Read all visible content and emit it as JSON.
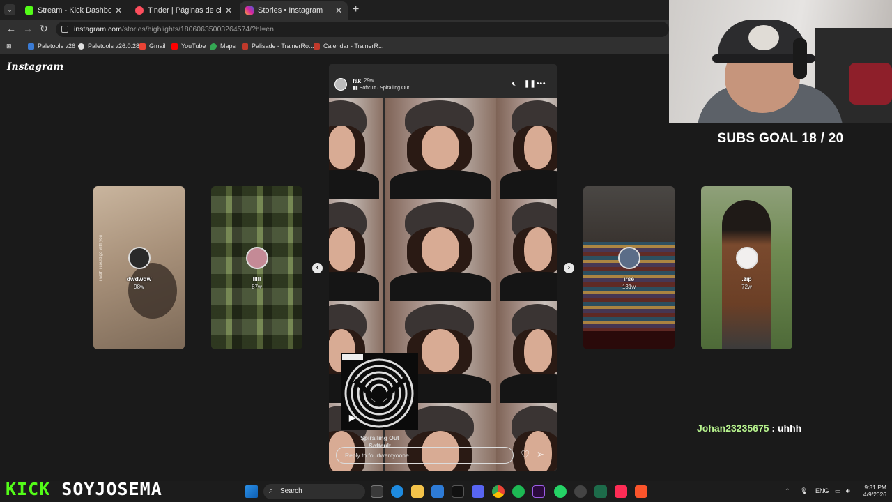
{
  "browser": {
    "tabs": [
      {
        "title": "Stream - Kick Dashboard",
        "favicon_color": "#53fc18",
        "active": false
      },
      {
        "title": "Tinder | Páginas de citas",
        "favicon_color": "#fd4e5d",
        "active": false
      },
      {
        "title": "Stories • Instagram",
        "favicon_color": "#d6249f",
        "active": true
      }
    ],
    "url_main": "instagram.com",
    "url_rest": "/stories/highlights/18060635003264574/?hl=en",
    "bookmarks": [
      {
        "label": "Paletools v26",
        "icon_color": "#3a7bd5"
      },
      {
        "label": "Paletools v26.0.28",
        "icon_color": "#e0e0e0"
      },
      {
        "label": "Gmail",
        "icon_color": "#ea4335"
      },
      {
        "label": "YouTube",
        "icon_color": "#ff0000"
      },
      {
        "label": "Maps",
        "icon_color": "#34a853"
      },
      {
        "label": "Palisade - TrainerRo...",
        "icon_color": "#c0392b"
      },
      {
        "label": "Calendar - TrainerR...",
        "icon_color": "#c0392b"
      }
    ]
  },
  "instagram": {
    "logo": "Instagram",
    "side_stories": [
      {
        "name": "dwdwdw",
        "age": "98w",
        "caption": "i wish i could go with you"
      },
      {
        "name": "lllll",
        "age": "87w"
      },
      {
        "name": "irse",
        "age": "131w"
      },
      {
        "name": ".zip",
        "age": "72w"
      }
    ],
    "story": {
      "user": "fak",
      "age": "29w",
      "music": "Softcult · Spiralling Out",
      "song_title": "Spiralling Out",
      "song_artist": "Softcult",
      "reply_placeholder": "Reply to fourtwentyoone..."
    }
  },
  "stream": {
    "subs_goal": "SUBS GOAL 18 / 20",
    "chat_user": "Johan23235675",
    "chat_text": " : uhhh",
    "brand_kick": "KICK",
    "brand_name": "SOYJOSEMA"
  },
  "taskbar": {
    "search_label": "Search",
    "lang": "ENG",
    "time": "9:31 PM",
    "date": "4/9/2026"
  }
}
